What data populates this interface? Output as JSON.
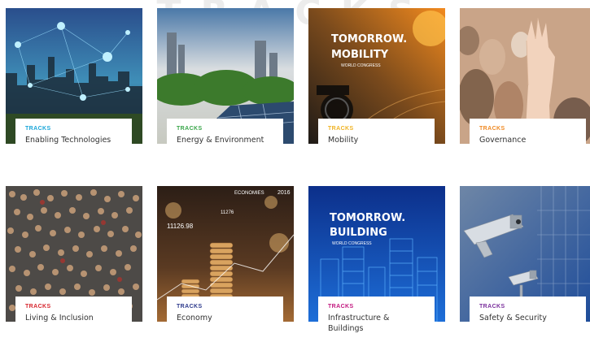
{
  "header": {
    "title": "TRACKS"
  },
  "cards": [
    {
      "tag": "TRACKS",
      "name": "Enabling Technologies",
      "tag_color": "#1aa6d9"
    },
    {
      "tag": "TRACKS",
      "name": "Energy & Environment",
      "tag_color": "#3aa64a"
    },
    {
      "tag": "TRACKS",
      "name": "Mobility",
      "tag_color": "#f0b323"
    },
    {
      "tag": "TRACKS",
      "name": "Governance",
      "tag_color": "#f08a24"
    },
    {
      "tag": "TRACKS",
      "name": "Living & Inclusion",
      "tag_color": "#d7262e"
    },
    {
      "tag": "TRACKS",
      "name": "Economy",
      "tag_color": "#2d3a8c"
    },
    {
      "tag": "TRACKS",
      "name": "Infrastructure & Buildings",
      "tag_color": "#c2187f"
    },
    {
      "tag": "TRACKS",
      "name": "Safety & Security",
      "tag_color": "#7a2f9c"
    }
  ],
  "overlays": {
    "mobility": {
      "line1": "TOMORROW.",
      "line2": "MOBILITY",
      "sub": "WORLD CONGRESS"
    },
    "building": {
      "line1": "TOMORROW.",
      "line2": "BUILDING",
      "sub": "WORLD CONGRESS"
    },
    "economy": {
      "value1": "11126.98",
      "value2": "11276",
      "word": "ECONOMIES",
      "year": "2016"
    }
  }
}
